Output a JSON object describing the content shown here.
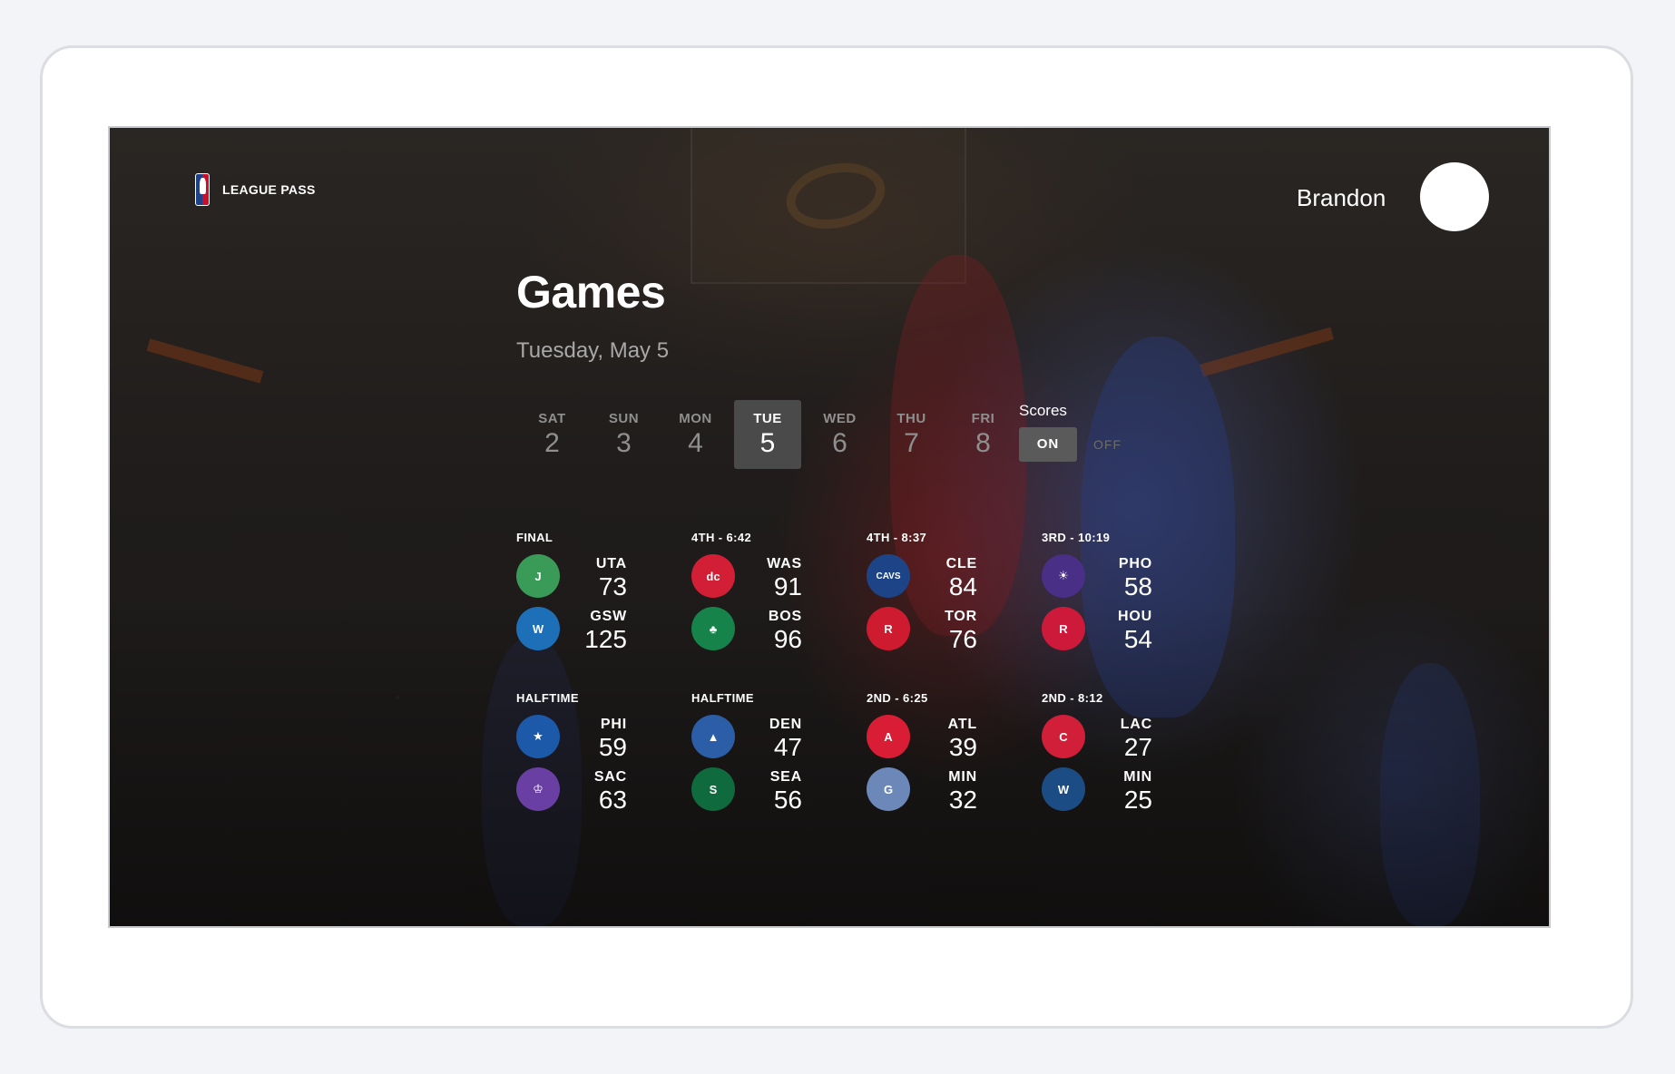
{
  "header": {
    "brand": "LEAGUE PASS",
    "user_name": "Brandon"
  },
  "page": {
    "title": "Games",
    "date": "Tuesday, May 5"
  },
  "days": [
    {
      "dow": "SAT",
      "num": "2",
      "active": false
    },
    {
      "dow": "SUN",
      "num": "3",
      "active": false
    },
    {
      "dow": "MON",
      "num": "4",
      "active": false
    },
    {
      "dow": "TUE",
      "num": "5",
      "active": true
    },
    {
      "dow": "WED",
      "num": "6",
      "active": false
    },
    {
      "dow": "THU",
      "num": "7",
      "active": false
    },
    {
      "dow": "FRI",
      "num": "8",
      "active": false
    }
  ],
  "scores_toggle": {
    "label": "Scores",
    "on": "ON",
    "off": "OFF",
    "selected": "ON"
  },
  "games": [
    {
      "status": "FINAL",
      "teams": [
        {
          "abbr": "UTA",
          "score": "73",
          "color": "#3a9a57",
          "icon": "jazz-logo"
        },
        {
          "abbr": "GSW",
          "score": "125",
          "color": "#1d6fb8",
          "icon": "warriors-logo"
        }
      ]
    },
    {
      "status": "4TH - 6:42",
      "teams": [
        {
          "abbr": "WAS",
          "score": "91",
          "color": "#d21f35",
          "icon": "wizards-logo"
        },
        {
          "abbr": "BOS",
          "score": "96",
          "color": "#16844a",
          "icon": "celtics-logo"
        }
      ]
    },
    {
      "status": "4TH - 8:37",
      "teams": [
        {
          "abbr": "CLE",
          "score": "84",
          "color": "#1e4488",
          "icon": "cavaliers-logo"
        },
        {
          "abbr": "TOR",
          "score": "76",
          "color": "#cf1b2f",
          "icon": "raptors-logo"
        }
      ]
    },
    {
      "status": "3RD - 10:19",
      "teams": [
        {
          "abbr": "PHO",
          "score": "58",
          "color": "#4a2f86",
          "icon": "suns-logo"
        },
        {
          "abbr": "HOU",
          "score": "54",
          "color": "#ce1a3a",
          "icon": "rockets-logo"
        }
      ]
    },
    {
      "status": "HALFTIME",
      "teams": [
        {
          "abbr": "PHI",
          "score": "59",
          "color": "#1c5aa9",
          "icon": "76ers-logo"
        },
        {
          "abbr": "SAC",
          "score": "63",
          "color": "#6a3fa3",
          "icon": "kings-logo"
        }
      ]
    },
    {
      "status": "HALFTIME",
      "teams": [
        {
          "abbr": "DEN",
          "score": "47",
          "color": "#2b5ea7",
          "icon": "nuggets-logo"
        },
        {
          "abbr": "SEA",
          "score": "56",
          "color": "#0f6b3d",
          "icon": "supersonics-logo"
        }
      ]
    },
    {
      "status": "2ND - 6:25",
      "teams": [
        {
          "abbr": "ATL",
          "score": "39",
          "color": "#d81d34",
          "icon": "hawks-logo"
        },
        {
          "abbr": "MIN",
          "score": "32",
          "color": "#6b88b8",
          "icon": "grizzlies-logo"
        }
      ]
    },
    {
      "status": "2ND - 8:12",
      "teams": [
        {
          "abbr": "LAC",
          "score": "27",
          "color": "#d11f3a",
          "icon": "clippers-logo"
        },
        {
          "abbr": "MIN",
          "score": "25",
          "color": "#1b4d84",
          "icon": "timberwolves-logo"
        }
      ]
    }
  ]
}
